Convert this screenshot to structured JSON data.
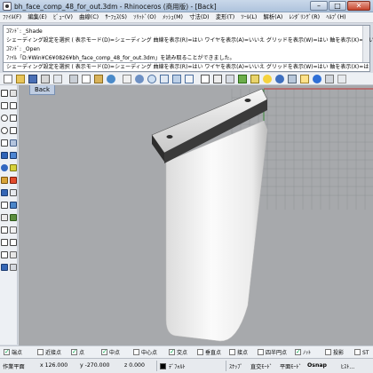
{
  "window": {
    "title": "bh_face_comp_48_for_out.3dm - Rhinoceros (商用版) - [Back]",
    "buttons": {
      "minimize": "–",
      "maximize": "□",
      "close": "✕"
    }
  },
  "menubar": [
    "ﾌｧｲﾙ(F)",
    "編集(E)",
    "ﾋﾞｭｰ(V)",
    "曲線(C)",
    "ｻｰﾌｪｽ(S)",
    "ｿﾘｯﾄﾞ(O)",
    "ﾒｯｼｭ(M)",
    "寸法(D)",
    "変形(T)",
    "ﾂｰﾙ(L)",
    "解析(A)",
    "ﾚﾝﾀﾞﾘﾝｸﾞ(R)",
    "ﾍﾙﾌﾟ(H)"
  ],
  "command": {
    "history": [
      "ｺﾏﾝﾄﾞ: _Shade",
      "シェーディング設定を選択 ( 表示モード(D)=シェーディング 曲線を表示(R)=はい ワイヤを表示(A)=いいえ グリッドを表示(W)=はい 軸を表示(X)=はい ):",
      "ｺﾏﾝﾄﾞ: _Open",
      "ﾌｧｲﾙ「D:¥Win¥C6¥0826¥bh_face_comp_48_for_out.3dm」を読み取ることができました。"
    ],
    "prompt": "シェーディング設定を選択 ( 表示モード(D)=シェーディング 曲線を表示(R)=はい ワイヤを表示(A)=いいえ グリッドを表示(W)=はい 軸を表示(X)=はい ):"
  },
  "viewport": {
    "tab_label": "Back"
  },
  "osnap": [
    {
      "label": "端点",
      "checked": true
    },
    {
      "label": "近接点",
      "checked": false
    },
    {
      "label": "点",
      "checked": true
    },
    {
      "label": "中点",
      "checked": true
    },
    {
      "label": "中心点",
      "checked": false
    },
    {
      "label": "交点",
      "checked": true
    },
    {
      "label": "垂直点",
      "checked": false
    },
    {
      "label": "接点",
      "checked": false
    },
    {
      "label": "四半円点",
      "checked": false
    },
    {
      "label": "ﾉｯﾄ",
      "checked": true
    },
    {
      "label": "投影",
      "checked": false
    },
    {
      "label": "ST",
      "checked": false
    }
  ],
  "status": {
    "plane": "作業平面",
    "x": "x 126.000",
    "y": "y -270.000",
    "z": "z 0.000",
    "layer": "ﾃﾞﾌｫﾙﾄ",
    "snap": "ｽﾅｯﾌﾟ",
    "ortho": "直交ﾓｰﾄﾞ",
    "planar": "平面ﾓｰﾄﾞ",
    "osnap": "Osnap",
    "history": "ﾋｽﾄ..."
  },
  "colors": {
    "viewport_bg": "#a7a9ac",
    "model": "#f3f3f3",
    "bracket": "#2d2d2d",
    "titlebar": "#b9cbe0"
  }
}
